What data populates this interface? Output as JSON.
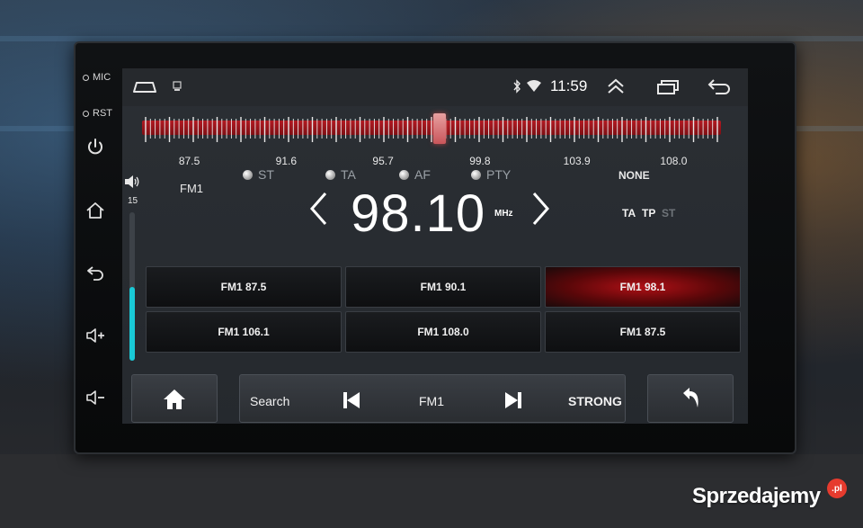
{
  "side_panel": {
    "mic_label": "MIC",
    "rst_label": "RST",
    "buttons": [
      "power-icon",
      "home-icon",
      "back-icon",
      "volume-up-icon",
      "volume-down-icon"
    ]
  },
  "statusbar": {
    "time": "11:59",
    "icons": [
      "home-outline-icon",
      "notification-icon",
      "bluetooth-icon",
      "wifi-icon",
      "expand-icon",
      "recent-apps-icon",
      "back-arrow-icon"
    ]
  },
  "tuner": {
    "scale_labels": [
      "87.5",
      "91.6",
      "95.7",
      "99.8",
      "103.9",
      "108.0"
    ],
    "options": [
      "ST",
      "TA",
      "AF",
      "PTY"
    ],
    "pty_value": "NONE",
    "band": "FM1",
    "volume": "15",
    "volume_level": 0.5,
    "frequency": "98.10",
    "unit": "MHz",
    "flags": [
      {
        "label": "TA",
        "active": true
      },
      {
        "label": "TP",
        "active": true
      },
      {
        "label": "ST",
        "active": false
      }
    ],
    "needle_value": 98.1
  },
  "presets": [
    {
      "label": "FM1 87.5",
      "active": false
    },
    {
      "label": "FM1 90.1",
      "active": false
    },
    {
      "label": "FM1 98.1",
      "active": true
    },
    {
      "label": "FM1 106.1",
      "active": false
    },
    {
      "label": "FM1 108.0",
      "active": false
    },
    {
      "label": "FM1 87.5",
      "active": false
    }
  ],
  "bottom_bar": {
    "search_label": "Search",
    "band_label": "FM1",
    "signal_label": "STRONG"
  },
  "watermark": {
    "brand": "Sprzedajemy",
    "badge": ".pl"
  },
  "colors": {
    "accent": "#19c9d6",
    "scale_red": "#b11a22",
    "preset_active": "#b01016"
  }
}
